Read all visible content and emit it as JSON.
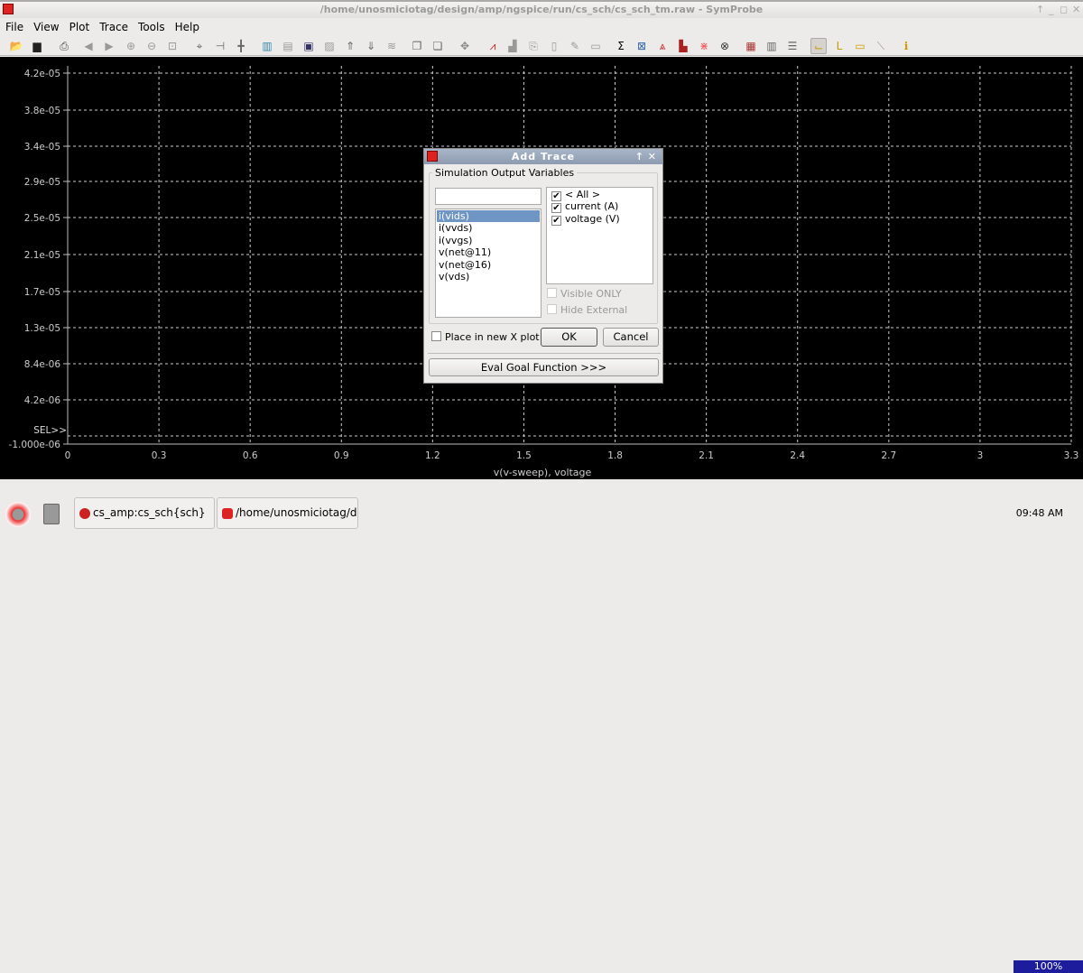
{
  "window": {
    "title": "/home/unosmiciotag/design/amp/ngspice/run/cs_sch/cs_sch_tm.raw - SymProbe",
    "controls": [
      "↑",
      "_",
      "◻",
      "✕"
    ]
  },
  "menu": [
    "File",
    "View",
    "Plot",
    "Trace",
    "Tools",
    "Help"
  ],
  "toolbar": [
    {
      "icon": "open-folder-icon",
      "glyph": "📂"
    },
    {
      "icon": "save-icon",
      "glyph": "▆"
    },
    {
      "icon": "print-icon",
      "glyph": "⎙"
    },
    {
      "icon": "back-icon",
      "glyph": "◀"
    },
    {
      "icon": "forward-icon",
      "glyph": "▶"
    },
    {
      "icon": "zoom-in-icon",
      "glyph": "⊕"
    },
    {
      "icon": "zoom-out-icon",
      "glyph": "⊖"
    },
    {
      "icon": "zoom-fit-icon",
      "glyph": "⊡"
    },
    {
      "icon": "cursor-point-icon",
      "glyph": "⌖"
    },
    {
      "icon": "cursor-horizontal-icon",
      "glyph": "⊣"
    },
    {
      "icon": "cursor-cross-icon",
      "glyph": "╋"
    },
    {
      "icon": "axis-icon",
      "glyph": "▥"
    },
    {
      "icon": "axis2-icon",
      "glyph": "▤"
    },
    {
      "icon": "monitor-icon",
      "glyph": "▣"
    },
    {
      "icon": "image-icon",
      "glyph": "▨"
    },
    {
      "icon": "export-icon",
      "glyph": "⇑"
    },
    {
      "icon": "import-icon",
      "glyph": "⇓"
    },
    {
      "icon": "graph-icon",
      "glyph": "≋"
    },
    {
      "icon": "window-icon",
      "glyph": "❐"
    },
    {
      "icon": "window2-icon",
      "glyph": "❏"
    },
    {
      "icon": "move-icon",
      "glyph": "✥"
    },
    {
      "icon": "trace-red-icon",
      "glyph": "⩘"
    },
    {
      "icon": "histogram-icon",
      "glyph": "▟"
    },
    {
      "icon": "copy-icon",
      "glyph": "⎘"
    },
    {
      "icon": "paste-icon",
      "glyph": "▯"
    },
    {
      "icon": "edit-icon",
      "glyph": "✎"
    },
    {
      "icon": "delete-icon",
      "glyph": "▭"
    },
    {
      "icon": "sigma-icon",
      "glyph": "Σ"
    },
    {
      "icon": "eye-diagram-icon",
      "glyph": "⊠"
    },
    {
      "icon": "spectrum-icon",
      "glyph": "⩓"
    },
    {
      "icon": "bars-icon",
      "glyph": "▙"
    },
    {
      "icon": "fft-icon",
      "glyph": "⋇"
    },
    {
      "icon": "mesh-icon",
      "glyph": "⊗"
    },
    {
      "icon": "grid-icon",
      "glyph": "▦"
    },
    {
      "icon": "columns-icon",
      "glyph": "▥"
    },
    {
      "icon": "rows-icon",
      "glyph": "☰"
    },
    {
      "icon": "marker-icon",
      "glyph": "⌙"
    },
    {
      "icon": "marker-l-icon",
      "glyph": "L"
    },
    {
      "icon": "note-icon",
      "glyph": "▭"
    },
    {
      "icon": "slope-icon",
      "glyph": "⟍"
    },
    {
      "icon": "info-icon",
      "glyph": "ℹ"
    }
  ],
  "chart_data": {
    "type": "line",
    "series": [],
    "xlabel": "v(v-sweep), voltage",
    "xlim": [
      0,
      3.3
    ],
    "x_ticks": [
      "0",
      "0.3",
      "0.6",
      "0.9",
      "1.2",
      "1.5",
      "1.8",
      "2.1",
      "2.4",
      "2.7",
      "3",
      "3.3"
    ],
    "y_ticks": [
      "4.2e-05",
      "3.8e-05",
      "3.4e-05",
      "2.9e-05",
      "2.5e-05",
      "2.1e-05",
      "1.7e-05",
      "1.3e-05",
      "8.4e-06",
      "4.2e-06",
      "-1.000e-06"
    ],
    "ylim": [
      -1e-06,
      4.2e-05
    ],
    "grid": true,
    "sel_label": "SEL>>",
    "colors": {
      "background": "#000000",
      "grid": "#cccccc"
    }
  },
  "status": {
    "zoom": "100%"
  },
  "dialog": {
    "title": "Add Trace",
    "group": "Simulation Output Variables",
    "filter_value": "",
    "variables": [
      "i(vids)",
      "i(vvds)",
      "i(vvgs)",
      "v(net@11)",
      "v(net@16)",
      "v(vds)"
    ],
    "selected": 0,
    "types": [
      {
        "label": "< All >",
        "checked": true
      },
      {
        "label": "current (A)",
        "checked": true
      },
      {
        "label": "voltage (V)",
        "checked": true
      }
    ],
    "visible_only": "Visible ONLY",
    "hide_external": "Hide External",
    "new_x_plot": "Place in new X plot",
    "ok": "OK",
    "cancel": "Cancel",
    "eval": "Eval Goal Function >>>"
  },
  "taskbar": {
    "tasks": [
      "cs_amp:cs_sch{sch}",
      "/home/unosmiciotag/de..."
    ],
    "clock": "09:48 AM"
  }
}
